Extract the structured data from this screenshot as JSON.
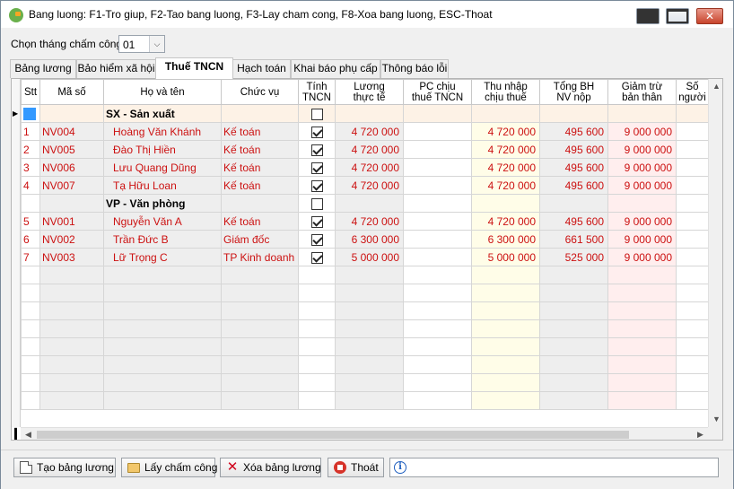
{
  "window": {
    "title": "Bang luong: F1-Tro giup, F2-Tao bang luong, F3-Lay cham cong, F8-Xoa bang luong, ESC-Thoat"
  },
  "month": {
    "label": "Chọn tháng chấm công:",
    "value": "01"
  },
  "tabs": [
    {
      "label": "Bảng lương"
    },
    {
      "label": "Bảo hiểm xã hội"
    },
    {
      "label": "Thuế TNCN",
      "active": true
    },
    {
      "label": "Hạch toán"
    },
    {
      "label": "Khai báo phụ cấp"
    },
    {
      "label": "Thông báo lỗi"
    }
  ],
  "columns": [
    {
      "label": "Stt",
      "label2": ""
    },
    {
      "label": "Mã số",
      "label2": ""
    },
    {
      "label": "Họ và tên",
      "label2": ""
    },
    {
      "label": "Chức vụ",
      "label2": ""
    },
    {
      "label": "Tính",
      "label2": "TNCN"
    },
    {
      "label": "Lương",
      "label2": "thực tế"
    },
    {
      "label": "PC chịu",
      "label2": "thuế TNCN"
    },
    {
      "label": "Thu nhập",
      "label2": "chịu thuế"
    },
    {
      "label": "Tổng BH",
      "label2": "NV nộp"
    },
    {
      "label": "Giảm trừ",
      "label2": "bản thân"
    },
    {
      "label": "Số",
      "label2": "người"
    }
  ],
  "groups": [
    {
      "name": "SX - Sản xuất",
      "rows": [
        {
          "stt": "1",
          "code": "NV004",
          "name": "Hoàng Văn Khánh",
          "position": "Kế toán",
          "tncn": true,
          "salary": "4 720 000",
          "pc": "",
          "taxable": "4 720 000",
          "insurance": "495 600",
          "deduction": "9 000 000"
        },
        {
          "stt": "2",
          "code": "NV005",
          "name": "Đào Thị Hiền",
          "position": "Kế toán",
          "tncn": true,
          "salary": "4 720 000",
          "pc": "",
          "taxable": "4 720 000",
          "insurance": "495 600",
          "deduction": "9 000 000"
        },
        {
          "stt": "3",
          "code": "NV006",
          "name": "Lưu Quang Dũng",
          "position": "Kế toán",
          "tncn": true,
          "salary": "4 720 000",
          "pc": "",
          "taxable": "4 720 000",
          "insurance": "495 600",
          "deduction": "9 000 000"
        },
        {
          "stt": "4",
          "code": "NV007",
          "name": "Tạ Hữu Loan",
          "position": "Kế toán",
          "tncn": true,
          "salary": "4 720 000",
          "pc": "",
          "taxable": "4 720 000",
          "insurance": "495 600",
          "deduction": "9 000 000"
        }
      ]
    },
    {
      "name": "VP - Văn phòng",
      "rows": [
        {
          "stt": "5",
          "code": "NV001",
          "name": "Nguyễn Văn A",
          "position": "Kế toán",
          "tncn": true,
          "salary": "4 720 000",
          "pc": "",
          "taxable": "4 720 000",
          "insurance": "495 600",
          "deduction": "9 000 000"
        },
        {
          "stt": "6",
          "code": "NV002",
          "name": "Trần Đức B",
          "position": "Giám đốc",
          "tncn": true,
          "salary": "6 300 000",
          "pc": "",
          "taxable": "6 300 000",
          "insurance": "661 500",
          "deduction": "9 000 000"
        },
        {
          "stt": "7",
          "code": "NV003",
          "name": "Lữ Trọng C",
          "position": "TP Kinh doanh",
          "tncn": true,
          "salary": "5 000 000",
          "pc": "",
          "taxable": "5 000 000",
          "insurance": "525 000",
          "deduction": "9 000 000"
        }
      ]
    }
  ],
  "buttons": {
    "create": "Tạo bảng lương",
    "fetch": "Lấy chấm công",
    "delete": "Xóa bảng lương",
    "exit": "Thoát"
  },
  "status": ""
}
